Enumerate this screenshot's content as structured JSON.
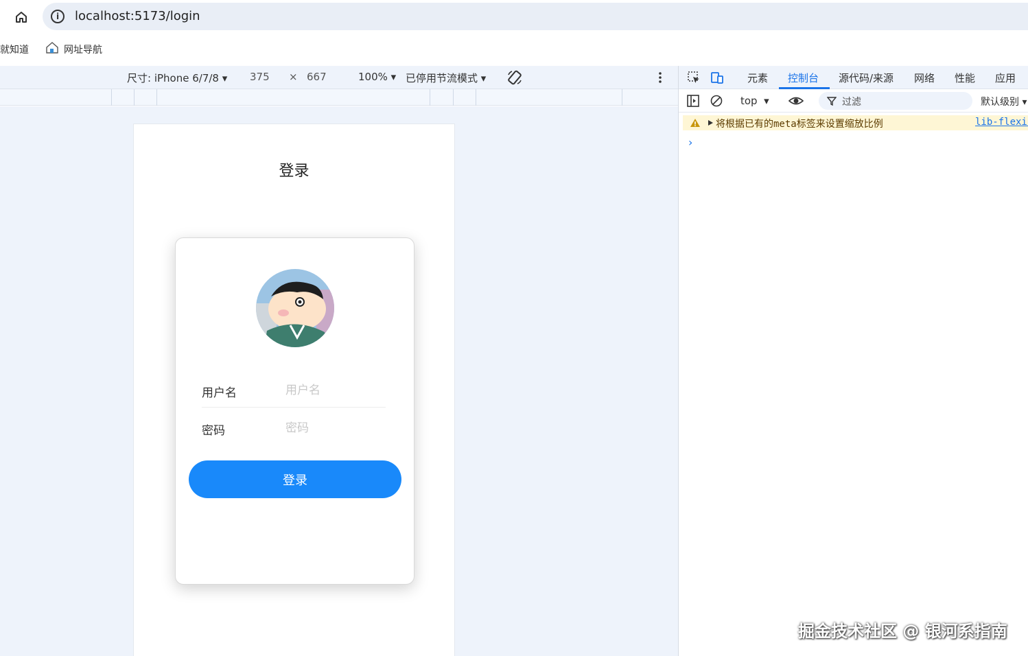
{
  "browser": {
    "url": "localhost:5173/login",
    "bookmarks": [
      "就知道",
      "网址导航"
    ]
  },
  "device_toolbar": {
    "dimensions_label": "尺寸: iPhone 6/7/8",
    "width": "375",
    "times": "×",
    "height": "667",
    "zoom": "100%",
    "throttle": "已停用节流模式"
  },
  "page": {
    "title": "登录",
    "username_label": "用户名",
    "username_placeholder": "用户名",
    "password_label": "密码",
    "password_placeholder": "密码",
    "login_button": "登录"
  },
  "devtools": {
    "tabs": [
      "元素",
      "控制台",
      "源代码/来源",
      "网络",
      "性能",
      "应用"
    ],
    "active_tab": "控制台",
    "context": "top",
    "filter_placeholder": "过滤",
    "level": "默认级别",
    "console_warning": "将根据已有的meta标签来设置缩放比例",
    "console_warning_source": "lib-flexib",
    "prompt": "›"
  },
  "watermark": "掘金技术社区 @ 银河系指南",
  "colors": {
    "primary": "#1989fa",
    "devtools_accent": "#1a73e8",
    "warning_bg": "#fef6d5"
  }
}
